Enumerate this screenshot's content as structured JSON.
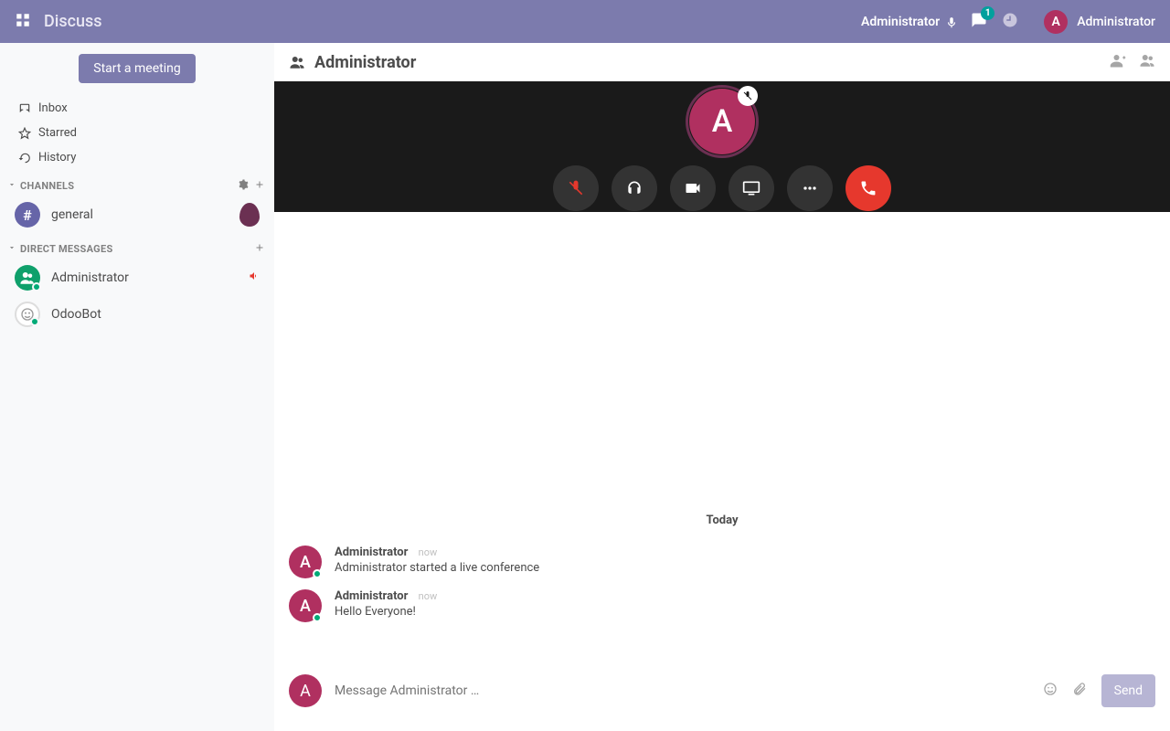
{
  "navbar": {
    "brand": "Discuss",
    "voice_user": "Administrator",
    "messaging_badge": "1",
    "username": "Administrator",
    "avatar_initial": "A"
  },
  "sidebar": {
    "start_meeting": "Start a meeting",
    "nav": {
      "inbox": "Inbox",
      "starred": "Starred",
      "history": "History"
    },
    "channels_label": "CHANNELS",
    "channels": [
      {
        "name": "general",
        "icon": "hash"
      }
    ],
    "dm_label": "DIRECT MESSAGES",
    "dms": [
      {
        "name": "Administrator",
        "active_call": true
      },
      {
        "name": "OdooBot",
        "active_call": false
      }
    ]
  },
  "thread": {
    "title": "Administrator",
    "call_avatar_initial": "A"
  },
  "messages": {
    "day": "Today",
    "items": [
      {
        "author": "Administrator",
        "time": "now",
        "text": "Administrator started a live conference",
        "initial": "A"
      },
      {
        "author": "Administrator",
        "time": "now",
        "text": "Hello Everyone!",
        "initial": "A"
      }
    ]
  },
  "composer": {
    "avatar_initial": "A",
    "placeholder": "Message Administrator …",
    "send": "Send"
  }
}
